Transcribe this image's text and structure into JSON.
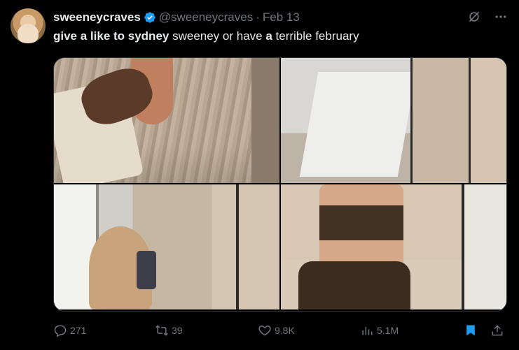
{
  "tweet": {
    "display_name": "sweeneycraves",
    "handle": "@sweeneycraves",
    "separator": "·",
    "date": "Feb 13",
    "text_parts": [
      {
        "text": "give a like to sydney",
        "bold": true
      },
      {
        "text": " sweeney or have ",
        "bold": false
      },
      {
        "text": "a",
        "bold": true
      },
      {
        "text": " terrible february",
        "bold": false
      }
    ]
  },
  "icons": {
    "verified": "verified-badge-icon",
    "grok": "grok-icon",
    "more": "more-icon",
    "reply": "reply-icon",
    "retweet": "retweet-icon",
    "like": "heart-icon",
    "views": "views-icon",
    "bookmark": "bookmark-icon",
    "share": "share-icon"
  },
  "colors": {
    "background": "#000000",
    "text_primary": "#e7e9ea",
    "text_secondary": "#71767b",
    "verified_blue": "#1d9bf0",
    "bookmark_blue": "#1d9bf0"
  },
  "metrics": {
    "replies": "271",
    "retweets": "39",
    "likes": "9.8K",
    "views": "5.1M"
  },
  "media": {
    "count": 4
  }
}
